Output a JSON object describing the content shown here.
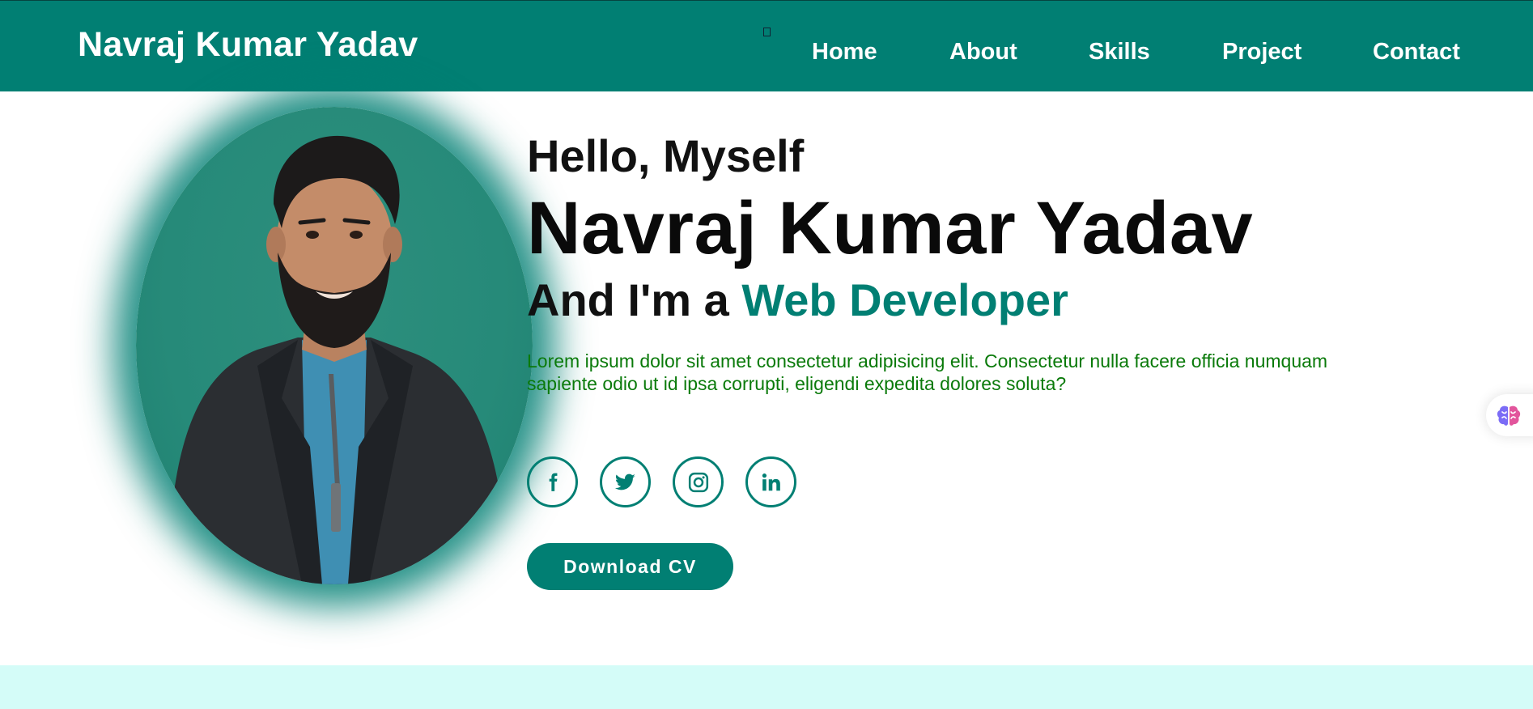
{
  "nav": {
    "brand": "Navraj Kumar Yadav",
    "links": [
      "Home",
      "About",
      "Skills",
      "Project",
      "Contact"
    ]
  },
  "hero": {
    "greeting": "Hello, Myself",
    "name": "Navraj Kumar Yadav",
    "role_prefix": "And I'm a",
    "role_highlight": "Web Developer",
    "description": "Lorem ipsum dolor sit amet consectetur adipisicing elit. Consectetur nulla facere officia numquam sapiente odio ut id ipsa corrupti, eligendi expedita dolores soluta?",
    "socials": [
      "facebook-icon",
      "twitter-icon",
      "instagram-icon",
      "linkedin-icon"
    ],
    "cv_button": "Download CV"
  },
  "colors": {
    "primary": "#017f73",
    "description_text": "#0a7a0a",
    "section_bg": "#d4fcf8"
  }
}
